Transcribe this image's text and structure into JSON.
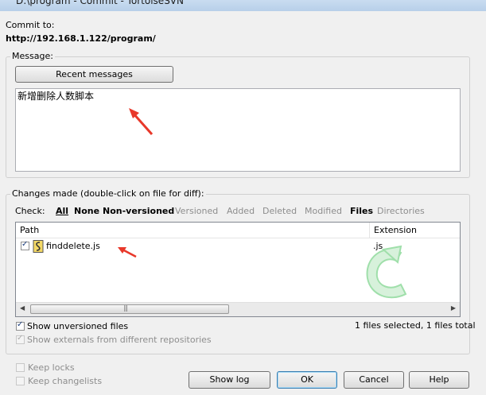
{
  "window": {
    "title": "D:\\program - Commit - TortoiseSVN"
  },
  "commit": {
    "label": "Commit to:",
    "url": "http://192.168.1.122/program/"
  },
  "message": {
    "group_label": "Message:",
    "recent_button": "Recent messages",
    "text": "新增删除人数脚本"
  },
  "changes": {
    "group_label": "Changes made (double-click on file for diff):",
    "check_label": "Check:",
    "filters": [
      {
        "label": "All",
        "enabled": true
      },
      {
        "label": "None",
        "enabled": true
      },
      {
        "label": "Non-versioned",
        "enabled": true
      },
      {
        "label": "Versioned",
        "enabled": false
      },
      {
        "label": "Added",
        "enabled": false
      },
      {
        "label": "Deleted",
        "enabled": false
      },
      {
        "label": "Modified",
        "enabled": false
      },
      {
        "label": "Files",
        "enabled": true
      },
      {
        "label": "Directories",
        "enabled": false
      }
    ],
    "columns": [
      "Path",
      "Extension"
    ],
    "rows": [
      {
        "path": "finddelete.js",
        "extension": ".js",
        "checked": true
      }
    ],
    "show_unversioned": "Show unversioned files",
    "show_externals": "Show externals from different repositories",
    "status": "1 files selected, 1 files total"
  },
  "options": {
    "keep_locks": "Keep locks",
    "keep_changelists": "Keep changelists"
  },
  "buttons": {
    "show_log": "Show log",
    "ok": "OK",
    "cancel": "Cancel",
    "help": "Help"
  },
  "colors": {
    "annotation_arrow": "#e8382a",
    "svn_logo": "#7ed08a"
  }
}
